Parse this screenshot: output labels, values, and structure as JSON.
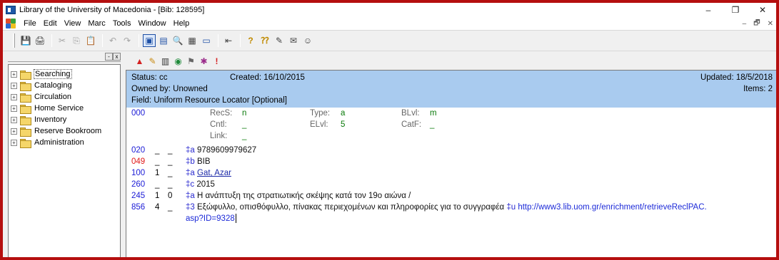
{
  "window": {
    "title": "Library of the University of Macedonia - [Bib: 128595]",
    "controls": [
      "–",
      "❐",
      "✕"
    ]
  },
  "menu": {
    "items": [
      "File",
      "Edit",
      "View",
      "Marc",
      "Tools",
      "Window",
      "Help"
    ],
    "mdi_controls": [
      "–",
      "🗗",
      "✕"
    ]
  },
  "toolbar": {
    "icons": [
      "save-icon",
      "print-icon",
      "cut-icon",
      "copy-icon",
      "paste-icon",
      "undo-icon",
      "redo-icon",
      "cascade-icon",
      "tile-icon",
      "find-icon",
      "bookmark-icon",
      "window-icon",
      "back-icon",
      "help-icon",
      "context-help-icon",
      "tools-icon",
      "messages-icon",
      "user-icon"
    ]
  },
  "sidebar": {
    "header_buttons": [
      "-",
      "x"
    ],
    "items": [
      {
        "label": "Searching",
        "selected": true
      },
      {
        "label": "Cataloging",
        "selected": false
      },
      {
        "label": "Circulation",
        "selected": false
      },
      {
        "label": "Home Service",
        "selected": false
      },
      {
        "label": "Inventory",
        "selected": false
      },
      {
        "label": "Reserve Bookroom",
        "selected": false
      },
      {
        "label": "Administration",
        "selected": false
      }
    ]
  },
  "record_toolbar": {
    "icons": [
      "alert-icon",
      "edit-icon",
      "barcode-icon",
      "globe-icon",
      "bookmark-flag-icon",
      "link-icon",
      "exclamation-icon"
    ]
  },
  "record": {
    "status": "Status: cc",
    "created": "Created: 16/10/2015",
    "updated": "Updated: 18/5/2018",
    "owned_by": "Owned by: Unowned",
    "items": "Items: 2",
    "field_info": "Field: Uniform Resource Locator [Optional]",
    "fixed_tag": "000",
    "fixed_fields": {
      "recs_label": "RecS:",
      "recs_value": "n",
      "type_label": "Type:",
      "type_value": "a",
      "blvl_label": "BLvl:",
      "blvl_value": "m",
      "cntl_label": "Cntl:",
      "cntl_value": "_",
      "elvl_label": "ELvl:",
      "elvl_value": "5",
      "catf_label": "CatF:",
      "catf_value": "_",
      "link_label": "Link:",
      "link_value": "_"
    },
    "fields": [
      {
        "tag": "020",
        "ind1": "_",
        "ind2": "_",
        "sub": "‡a",
        "text": "9789609979627",
        "red": false
      },
      {
        "tag": "049",
        "ind1": "_",
        "ind2": "_",
        "sub": "‡b",
        "text": "BIB",
        "red": true
      },
      {
        "tag": "100",
        "ind1": "1",
        "ind2": "_",
        "sub": "‡a",
        "text": "Gat, Azar",
        "red": false
      },
      {
        "tag": "260",
        "ind1": "_",
        "ind2": "_",
        "sub": "‡c",
        "text": "2015",
        "red": false
      },
      {
        "tag": "245",
        "ind1": "1",
        "ind2": "0",
        "sub": "‡a",
        "text": "Η ανάπτυξη της στρατιωτικής σκέψης κατά τον 19ο αιώνα /",
        "red": false
      }
    ],
    "field_856": {
      "tag": "856",
      "ind1": "4",
      "ind2": "_",
      "sub3": "‡3",
      "text3": "Εξώφυλλο, οπισθόφυλλο, πίνακας περιεχομένων και πληροφορίες για το συγγραφέα",
      "subu": "‡u",
      "url_line1": "http://www3.lib.uom.gr/enrichment/retrieveReclPAC.",
      "url_line2": "asp?ID=9328"
    }
  }
}
